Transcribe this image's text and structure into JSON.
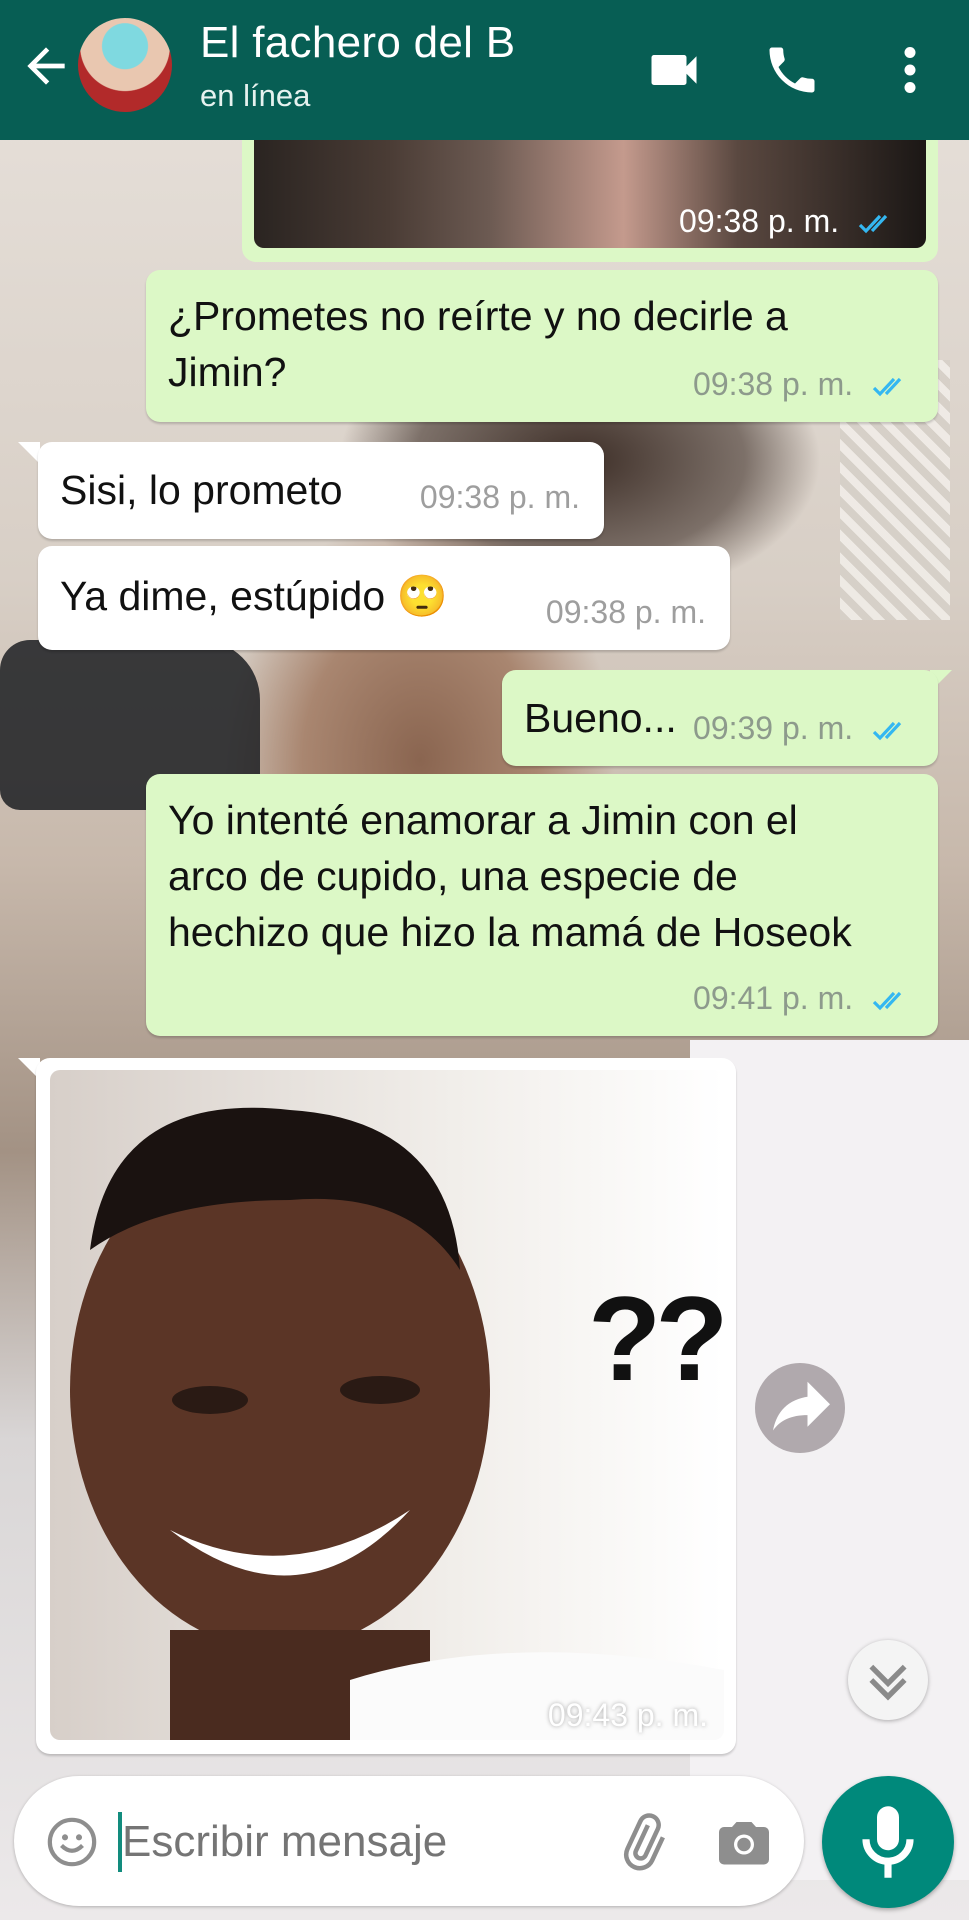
{
  "header": {
    "title": "El fachero del B",
    "status": "en línea",
    "back_icon": "arrow-left-icon",
    "video_icon": "video-camera-icon",
    "call_icon": "phone-icon",
    "menu_icon": "more-vertical-icon",
    "color": "#075e54"
  },
  "messages": {
    "m0": {
      "direction": "outgoing",
      "type": "image",
      "time": "09:38 p. m.",
      "read": true
    },
    "m1": {
      "direction": "outgoing",
      "text": "¿Prometes no reírte y no decirle a Jimin?",
      "time": "09:38 p. m.",
      "read": true
    },
    "m2": {
      "direction": "incoming",
      "text": "Sisi, lo prometo",
      "time": "09:38 p. m."
    },
    "m3": {
      "direction": "incoming",
      "text": "Ya dime, estúpido 🙄",
      "time": "09:38 p. m."
    },
    "m4": {
      "direction": "outgoing",
      "text": "Bueno...",
      "time": "09:39 p. m.",
      "read": true
    },
    "m5": {
      "direction": "outgoing",
      "text": "Yo intenté enamorar a Jimin con el arco de cupido, una especie de hechizo que hizo la mamá de Hoseok",
      "time": "09:41 p. m.",
      "read": true
    },
    "m6": {
      "direction": "incoming",
      "type": "image",
      "image_caption_text": "???",
      "time": "09:43 p. m."
    }
  },
  "composer": {
    "placeholder": "Escribir mensaje",
    "emoji_icon": "emoji-icon",
    "attach_icon": "paperclip-icon",
    "camera_icon": "camera-icon",
    "mic_icon": "microphone-icon"
  },
  "colors": {
    "outgoing_bubble": "#dcf8c6",
    "incoming_bubble": "#ffffff",
    "read_ticks": "#34b7f1",
    "mic_button": "#00897b"
  }
}
